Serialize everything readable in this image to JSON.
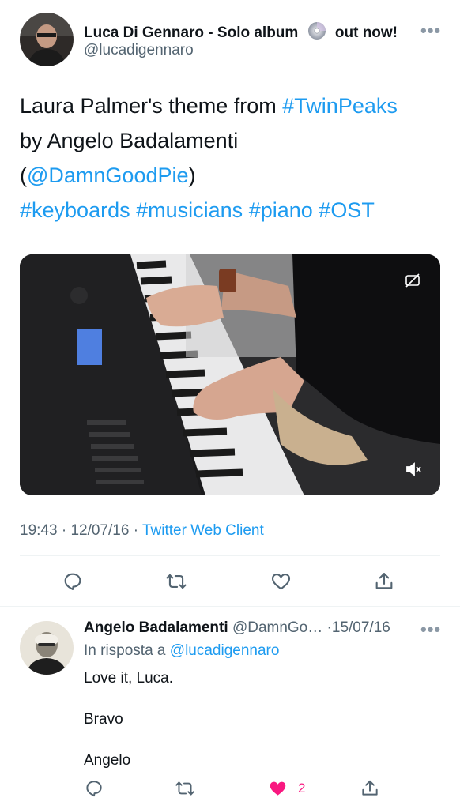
{
  "tweet": {
    "author_name": "Luca Di Gennaro - Solo album",
    "author_name_suffix": "out now!",
    "handle": "@lucadigennaro",
    "text": {
      "line1_prefix": "Laura Palmer's theme from ",
      "line1_hashtag": "#TwinPeaks",
      "line2": "by Angelo Badalamenti",
      "line3_open": "(",
      "line3_mention": "@DamnGoodPie",
      "line3_close": ")",
      "hashtags": [
        "#keyboards",
        "#musicians",
        "#piano",
        "#OST"
      ]
    },
    "time": "19:43",
    "date": "12/07/16",
    "source": "Twitter Web Client",
    "more_label": "•••"
  },
  "actions": [
    {
      "name": "reply",
      "icon": "comment-icon"
    },
    {
      "name": "retweet",
      "icon": "retweet-icon"
    },
    {
      "name": "like",
      "icon": "heart-icon"
    },
    {
      "name": "share",
      "icon": "share-icon"
    }
  ],
  "reply": {
    "author_name": "Angelo Badalamenti",
    "handle": "@DamnGo…",
    "date": "15/07/16",
    "replying_to_label": "In risposta a",
    "replying_to_handle": "@lucadigennaro",
    "body": [
      "Love it, Luca.",
      "Bravo",
      "Angelo"
    ],
    "like_count": "2",
    "more_label": "•••",
    "dot": "·"
  },
  "colors": {
    "accent": "#1d9bf0",
    "like": "#f91880",
    "secondary_text": "#536471"
  }
}
